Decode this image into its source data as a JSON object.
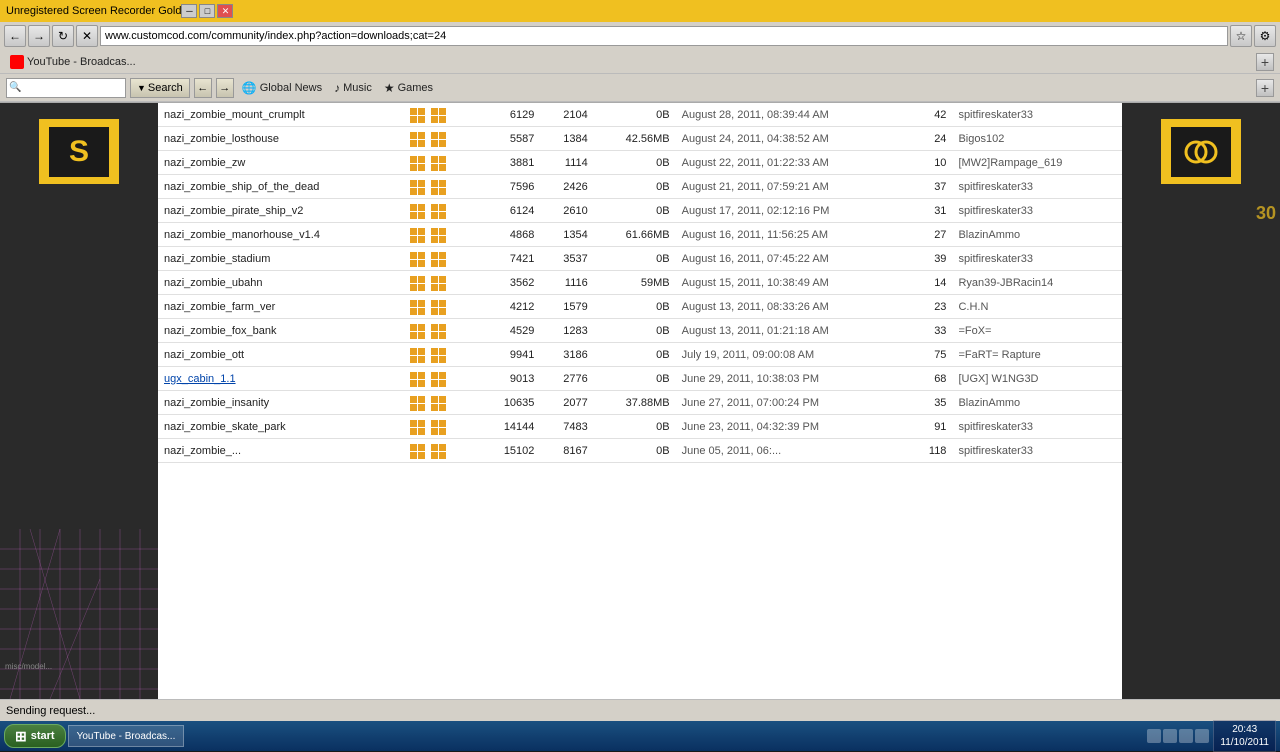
{
  "titlebar": {
    "title": "Unregistered Screen Recorder Gold",
    "minimize": "─",
    "maximize": "□",
    "close": "✕"
  },
  "browser": {
    "address": "www.customcod.com/community/index.php?action=downloads;cat=24",
    "back": "←",
    "forward": "→",
    "refresh": "↻",
    "stop": "✕"
  },
  "bookmarks": [
    {
      "label": "YouTube - Broadcas..."
    }
  ],
  "searchbar": {
    "placeholder": "",
    "search_label": "Search",
    "global_news": "Global News",
    "music": "Music",
    "games": "Games"
  },
  "table": {
    "rows": [
      {
        "name": "nazi_zombie_mount_crumplt",
        "col1": "6129",
        "col2": "2104",
        "size": "0B",
        "date": "August 28, 2011, 08:39:44 AM",
        "num": "42",
        "user": "spitfireskater33"
      },
      {
        "name": "nazi_zombie_losthouse",
        "col1": "5587",
        "col2": "1384",
        "size": "42.56MB",
        "date": "August 24, 2011, 04:38:52 AM",
        "num": "24",
        "user": "Bigos102"
      },
      {
        "name": "nazi_zombie_zw",
        "col1": "3881",
        "col2": "1114",
        "size": "0B",
        "date": "August 22, 2011, 01:22:33 AM",
        "num": "10",
        "user": "[MW2]Rampage_619"
      },
      {
        "name": "nazi_zombie_ship_of_the_dead",
        "col1": "7596",
        "col2": "2426",
        "size": "0B",
        "date": "August 21, 2011, 07:59:21 AM",
        "num": "37",
        "user": "spitfireskater33"
      },
      {
        "name": "nazi_zombie_pirate_ship_v2",
        "col1": "6124",
        "col2": "2610",
        "size": "0B",
        "date": "August 17, 2011, 02:12:16 PM",
        "num": "31",
        "user": "spitfireskater33"
      },
      {
        "name": "nazi_zombie_manorhouse_v1.4",
        "col1": "4868",
        "col2": "1354",
        "size": "61.66MB",
        "date": "August 16, 2011, 11:56:25 AM",
        "num": "27",
        "user": "BlazinAmmo"
      },
      {
        "name": "nazi_zombie_stadium",
        "col1": "7421",
        "col2": "3537",
        "size": "0B",
        "date": "August 16, 2011, 07:45:22 AM",
        "num": "39",
        "user": "spitfireskater33"
      },
      {
        "name": "nazi_zombie_ubahn",
        "col1": "3562",
        "col2": "1116",
        "size": "59MB",
        "date": "August 15, 2011, 10:38:49 AM",
        "num": "14",
        "user": "Ryan39-JBRacin14"
      },
      {
        "name": "nazi_zombie_farm_ver",
        "col1": "4212",
        "col2": "1579",
        "size": "0B",
        "date": "August 13, 2011, 08:33:26 AM",
        "num": "23",
        "user": "C.H.N"
      },
      {
        "name": "nazi_zombie_fox_bank",
        "col1": "4529",
        "col2": "1283",
        "size": "0B",
        "date": "August 13, 2011, 01:21:18 AM",
        "num": "33",
        "user": "=FoX="
      },
      {
        "name": "nazi_zombie_ott",
        "col1": "9941",
        "col2": "3186",
        "size": "0B",
        "date": "July 19, 2011, 09:00:08 AM",
        "num": "75",
        "user": "=FaRT= Rapture"
      },
      {
        "name": "ugx_cabin_1.1",
        "col1": "9013",
        "col2": "2776",
        "size": "0B",
        "date": "June 29, 2011, 10:38:03 PM",
        "num": "68",
        "user": "[UGX] W1NG3D"
      },
      {
        "name": "nazi_zombie_insanity",
        "col1": "10635",
        "col2": "2077",
        "size": "37.88MB",
        "date": "June 27, 2011, 07:00:24 PM",
        "num": "35",
        "user": "BlazinAmmo"
      },
      {
        "name": "nazi_zombie_skate_park",
        "col1": "14144",
        "col2": "7483",
        "size": "0B",
        "date": "June 23, 2011, 04:32:39 PM",
        "num": "91",
        "user": "spitfireskater33"
      },
      {
        "name": "nazi_zombie_...",
        "col1": "15102",
        "col2": "8167",
        "size": "0B",
        "date": "June 05, 2011, 06:...",
        "num": "118",
        "user": "spitfireskater33"
      }
    ]
  },
  "statusbar": {
    "text": "Sending request..."
  },
  "taskbar": {
    "start_label": "start",
    "items": [
      "YouTube - Broadcas..."
    ],
    "time": "20:43",
    "date": "11/10/2011"
  }
}
